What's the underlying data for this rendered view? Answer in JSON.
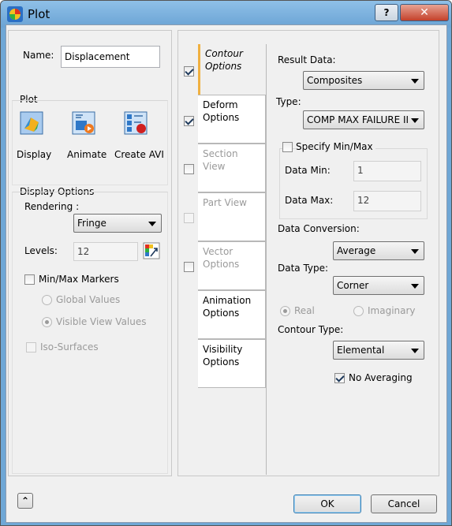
{
  "window": {
    "title": "Plot",
    "help_label": "?",
    "close_label": "✕"
  },
  "name": {
    "label": "Name:",
    "value": "Displacement"
  },
  "plot_group": {
    "label": "Plot",
    "actions": [
      {
        "label": "Display",
        "icon": "display-plot-icon"
      },
      {
        "label": "Animate",
        "icon": "animate-plot-icon"
      },
      {
        "label": "Create AVI",
        "icon": "create-avi-icon"
      }
    ]
  },
  "display_options": {
    "label": "Display Options",
    "rendering_label": "Rendering :",
    "rendering_value": "Fringe",
    "levels_label": "Levels:",
    "levels_value": "12",
    "minmax_label": "Min/Max Markers",
    "global_values": "Global Values",
    "visible_view_values": "Visible View Values",
    "iso_surfaces": "Iso-Surfaces"
  },
  "tabs": [
    {
      "label": "Contour Options",
      "checked": true,
      "enabled": true
    },
    {
      "label": "Deform Options",
      "checked": true,
      "enabled": true
    },
    {
      "label": "Section View",
      "checked": false,
      "enabled": false
    },
    {
      "label": "Part View",
      "checked": false,
      "enabled": false
    },
    {
      "label": "Vector Options",
      "checked": false,
      "enabled": false
    },
    {
      "label": "Animation Options",
      "enabled": true
    },
    {
      "label": "Visibility Options",
      "enabled": true
    }
  ],
  "contour": {
    "result_data_label": "Result Data:",
    "result_data_value": "Composites",
    "type_label": "Type:",
    "type_value": "COMP MAX FAILURE II",
    "specify_minmax_label": "Specify Min/Max",
    "data_min_label": "Data Min:",
    "data_min_value": "1",
    "data_max_label": "Data Max:",
    "data_max_value": "12",
    "data_conversion_label": "Data Conversion:",
    "data_conversion_value": "Average",
    "data_type_label": "Data Type:",
    "data_type_value": "Corner",
    "real_label": "Real",
    "imaginary_label": "Imaginary",
    "contour_type_label": "Contour Type:",
    "contour_type_value": "Elemental",
    "no_averaging_label": "No Averaging"
  },
  "footer": {
    "expand_label": "⌃",
    "ok_label": "OK",
    "cancel_label": "Cancel"
  }
}
